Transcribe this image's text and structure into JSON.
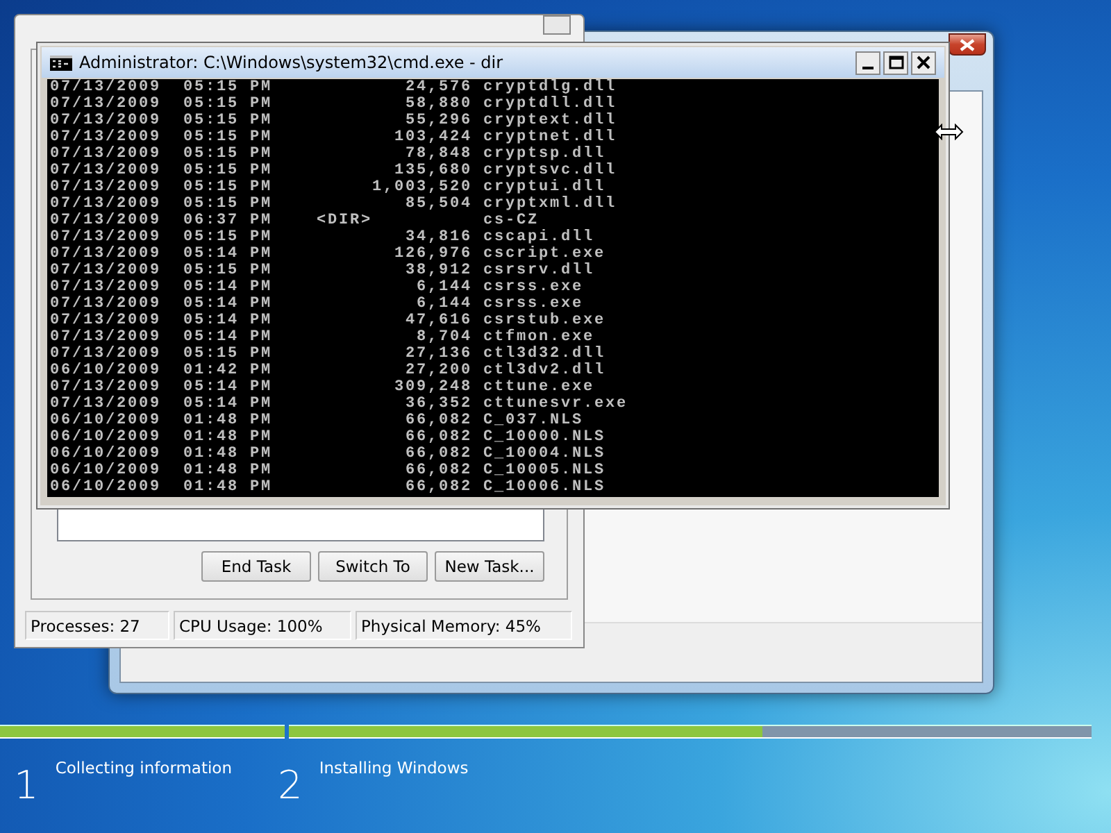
{
  "task_manager": {
    "buttons": [
      {
        "label": "End Task"
      },
      {
        "label": "Switch To"
      },
      {
        "label": "New Task..."
      }
    ],
    "status_bar": [
      "Processes: 27",
      "CPU Usage: 100%",
      "Physical Memory: 45%"
    ]
  },
  "console": {
    "title": "Administrator: C:\\Windows\\system32\\cmd.exe - dir",
    "lines": [
      "07/13/2009  05:15 PM            24,576 cryptdlg.dll",
      "07/13/2009  05:15 PM            58,880 cryptdll.dll",
      "07/13/2009  05:15 PM            55,296 cryptext.dll",
      "07/13/2009  05:15 PM           103,424 cryptnet.dll",
      "07/13/2009  05:15 PM            78,848 cryptsp.dll",
      "07/13/2009  05:15 PM           135,680 cryptsvc.dll",
      "07/13/2009  05:15 PM         1,003,520 cryptui.dll",
      "07/13/2009  05:15 PM            85,504 cryptxml.dll",
      "07/13/2009  06:37 PM    <DIR>          cs-CZ",
      "07/13/2009  05:15 PM            34,816 cscapi.dll",
      "07/13/2009  05:14 PM           126,976 cscript.exe",
      "07/13/2009  05:15 PM            38,912 csrsrv.dll",
      "07/13/2009  05:14 PM             6,144 csrss.exe",
      "07/13/2009  05:14 PM             6,144 csrss.exe",
      "07/13/2009  05:14 PM            47,616 csrstub.exe",
      "07/13/2009  05:14 PM             8,704 ctfmon.exe",
      "07/13/2009  05:15 PM            27,136 ctl3d32.dll",
      "06/10/2009  01:42 PM            27,200 ctl3dv2.dll",
      "07/13/2009  05:14 PM           309,248 cttune.exe",
      "07/13/2009  05:14 PM            36,352 cttunesvr.exe",
      "06/10/2009  01:48 PM            66,082 C_037.NLS",
      "06/10/2009  01:48 PM            66,082 C_10000.NLS",
      "06/10/2009  01:48 PM            66,082 C_10004.NLS",
      "06/10/2009  01:48 PM            66,082 C_10005.NLS",
      "06/10/2009  01:48 PM            66,082 C_10006.NLS"
    ]
  },
  "setup_progress": {
    "segments": [
      {
        "level": 1
      },
      {
        "level": 0.59
      }
    ],
    "steps": [
      {
        "number": "1",
        "label": "Collecting information"
      },
      {
        "number": "2",
        "label": "Installing Windows"
      }
    ]
  }
}
